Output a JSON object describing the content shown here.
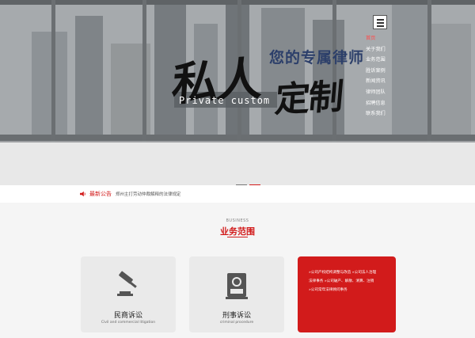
{
  "hero": {
    "tagline": "您的专属律师",
    "headline_part1": "私人",
    "headline_part2": "定制",
    "english": "Private custom"
  },
  "nav": {
    "items": [
      "首页",
      "关于我们",
      "业务范围",
      "胜诉案例",
      "新闻资讯",
      "律师团队",
      "招聘信息",
      "联系我们"
    ]
  },
  "notice": {
    "label": "最新公告",
    "text": "郑州主打劳动仲裁解释的法律规定"
  },
  "business": {
    "title_en": "BUSINESS",
    "title_zh": "业务范围",
    "cards": [
      {
        "title": "民商诉讼",
        "subtitle": "Civil and commercial litigation",
        "icon": "gavel-icon"
      },
      {
        "title": "刑事诉讼",
        "subtitle": "criminal procedure",
        "icon": "badge-icon"
      }
    ],
    "highlight_lines": [
      "»公司产权结构调整与改造  »公司法人治理",
      "法律事务 »公司破产、解散、清算、注销",
      "»公司常年法律顾问事务"
    ]
  },
  "colors": {
    "accent": "#d21b1b",
    "card": "#eaeaea",
    "background": "#f5f5f5"
  }
}
